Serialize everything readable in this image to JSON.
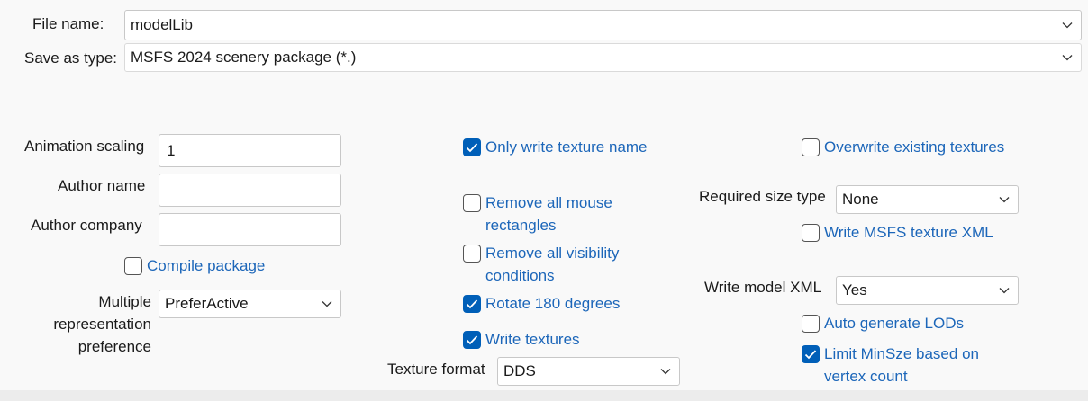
{
  "file": {
    "name_label": "File name:",
    "name_value": "modelLib",
    "type_label": "Save as type:",
    "type_value": "MSFS 2024 scenery package (*.)"
  },
  "options": {
    "animation_scaling_label": "Animation scaling",
    "animation_scaling_value": "1",
    "author_name_label": "Author name",
    "author_name_value": "",
    "author_company_label": "Author company",
    "author_company_value": "",
    "compile_package_label": "Compile package",
    "compile_package_checked": false,
    "multiple_rep_label_1": "Multiple",
    "multiple_rep_label_2": "representation",
    "multiple_rep_label_3": "preference",
    "multiple_rep_value": "PreferActive",
    "only_write_texture_name_label": "Only write texture name",
    "only_write_texture_name_checked": true,
    "remove_mouse_rect_label_1": "Remove all mouse",
    "remove_mouse_rect_label_2": "rectangles",
    "remove_mouse_rect_checked": false,
    "remove_visibility_label_1": "Remove all visibility",
    "remove_visibility_label_2": "conditions",
    "remove_visibility_checked": false,
    "rotate_label": "Rotate 180 degrees",
    "rotate_checked": true,
    "write_textures_label": "Write textures",
    "write_textures_checked": true,
    "texture_format_label": "Texture format",
    "texture_format_value": "DDS",
    "overwrite_textures_label": "Overwrite existing textures",
    "overwrite_textures_checked": false,
    "required_size_type_label": "Required size type",
    "required_size_type_value": "None",
    "write_msfs_texture_xml_label": "Write MSFS texture XML",
    "write_msfs_texture_xml_checked": false,
    "write_model_xml_label": "Write model XML",
    "write_model_xml_value": "Yes",
    "auto_generate_lods_label": "Auto generate LODs",
    "auto_generate_lods_checked": false,
    "limit_minsize_label_1": "Limit MinSze based on",
    "limit_minsize_label_2": "vertex count",
    "limit_minsize_checked": true
  },
  "colors": {
    "accent": "#005fb8",
    "link_text": "#1c66b9",
    "background": "#f9f9f9"
  },
  "icons": {
    "dropdown": "chevron-down-icon",
    "check": "checkmark-icon"
  }
}
